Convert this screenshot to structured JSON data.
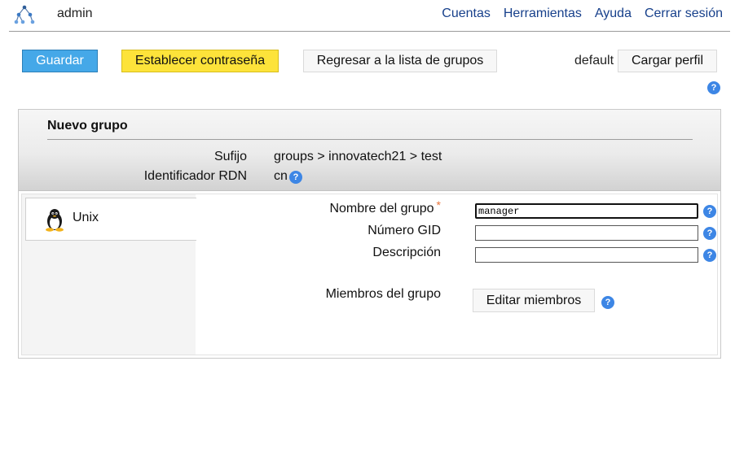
{
  "header": {
    "user": "admin",
    "nav": [
      "Cuentas",
      "Herramientas",
      "Ayuda",
      "Cerrar sesión"
    ]
  },
  "toolbar": {
    "save_label": "Guardar",
    "set_password_label": "Establecer contraseña",
    "back_label": "Regresar a la lista de grupos",
    "profile_name": "default",
    "load_profile_label": "Cargar perfil"
  },
  "help_glyph": "?",
  "panel": {
    "title": "Nuevo grupo",
    "suffix_label": "Sufijo",
    "suffix_value": "groups > innovatech21 > test",
    "rdn_label": "Identificador RDN",
    "rdn_value": "cn"
  },
  "tabs": [
    {
      "label": "Unix",
      "icon": "tux-icon"
    }
  ],
  "form": {
    "group_name_label": "Nombre del grupo",
    "required_mark": "*",
    "group_name_value": "manager",
    "gid_label": "Número GID",
    "gid_value": "",
    "description_label": "Descripción",
    "description_value": "",
    "members_label": "Miembros del grupo",
    "edit_members_label": "Editar miembros"
  },
  "colors": {
    "save": "#45a8e8",
    "set_password": "#fde33a",
    "link": "#17408b",
    "help": "#3d86e5",
    "required": "#e8743b"
  }
}
